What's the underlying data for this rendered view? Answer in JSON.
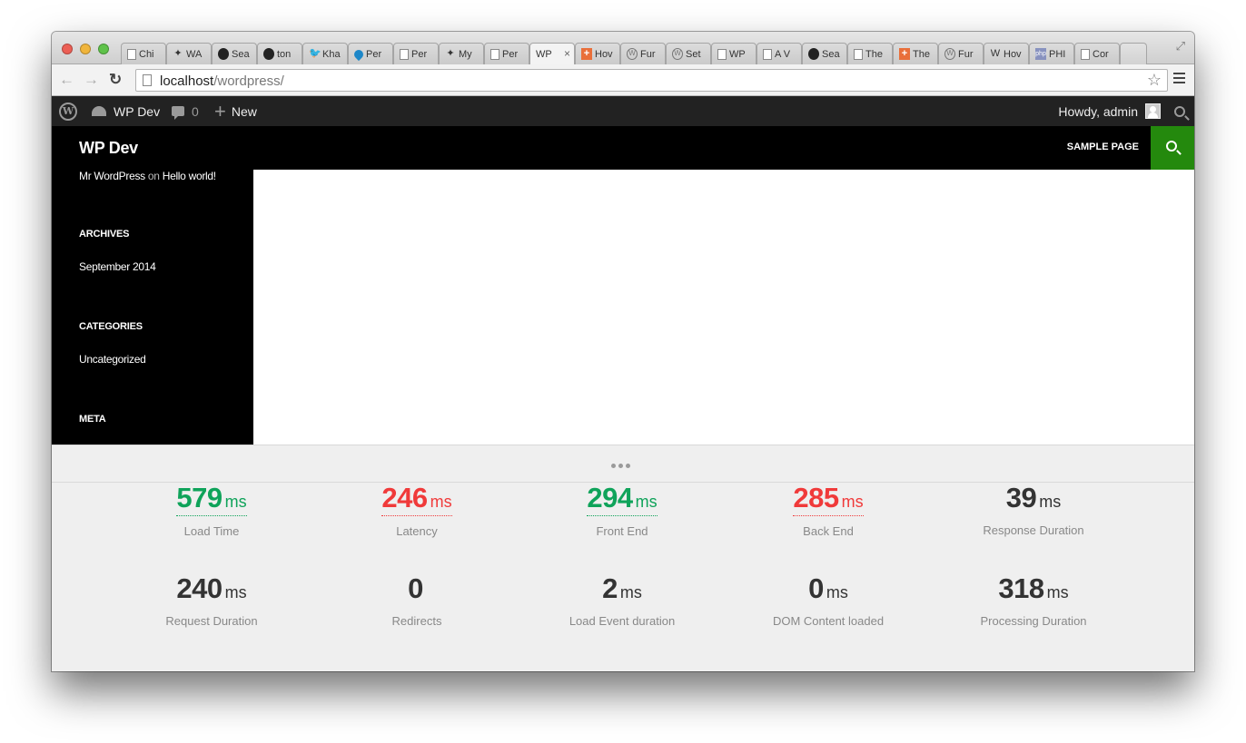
{
  "browser": {
    "tabs": [
      {
        "label": "Chi",
        "icon": "doc-icon"
      },
      {
        "label": "WA",
        "icon": "pinwheel-icon"
      },
      {
        "label": "Sea",
        "icon": "github-icon"
      },
      {
        "label": "ton",
        "icon": "github-icon"
      },
      {
        "label": "Kha",
        "icon": "twitter-icon"
      },
      {
        "label": "Per",
        "icon": "drupal-icon"
      },
      {
        "label": "Per",
        "icon": "doc-icon"
      },
      {
        "label": "My",
        "icon": "pinwheel-icon"
      },
      {
        "label": "Per",
        "icon": "doc-icon"
      },
      {
        "label": "WP",
        "icon": "none",
        "active": true
      },
      {
        "label": "Hov",
        "icon": "plus-cross-icon"
      },
      {
        "label": "Fur",
        "icon": "wordpress-icon"
      },
      {
        "label": "Set",
        "icon": "wordpress-icon"
      },
      {
        "label": "WP",
        "icon": "doc-icon"
      },
      {
        "label": "A V",
        "icon": "doc-icon"
      },
      {
        "label": "Sea",
        "icon": "github-icon"
      },
      {
        "label": "The",
        "icon": "doc-icon"
      },
      {
        "label": "The",
        "icon": "plus-cross-icon"
      },
      {
        "label": "Fur",
        "icon": "wordpress-icon"
      },
      {
        "label": "Hov",
        "icon": "wikipedia-icon"
      },
      {
        "label": "PHI",
        "icon": "php-icon"
      },
      {
        "label": "Cor",
        "icon": "doc-icon"
      }
    ],
    "url_host": "localhost",
    "url_path": "/wordpress/"
  },
  "adminbar": {
    "site_name": "WP Dev",
    "comment_count": "0",
    "new_label": "New",
    "howdy": "Howdy, admin"
  },
  "site": {
    "title": "WP Dev",
    "nav_sample_page": "SAMPLE PAGE"
  },
  "sidebar": {
    "recent_comment": {
      "author": "Mr WordPress",
      "on": "on",
      "post": "Hello world!"
    },
    "archives_title": "ARCHIVES",
    "archives_item": "September 2014",
    "categories_title": "CATEGORIES",
    "categories_item": "Uncategorized",
    "meta_title": "META"
  },
  "metrics": [
    {
      "value": "579",
      "unit": "ms",
      "label": "Load Time",
      "color": "#0fa35a"
    },
    {
      "value": "246",
      "unit": "ms",
      "label": "Latency",
      "color": "#f03a3a"
    },
    {
      "value": "294",
      "unit": "ms",
      "label": "Front End",
      "color": "#0fa35a"
    },
    {
      "value": "285",
      "unit": "ms",
      "label": "Back End",
      "color": "#f03a3a"
    },
    {
      "value": "39",
      "unit": "ms",
      "label": "Response Duration",
      "color": "#333333"
    },
    {
      "value": "240",
      "unit": "ms",
      "label": "Request Duration",
      "color": "#333333"
    },
    {
      "value": "0",
      "unit": "",
      "label": "Redirects",
      "color": "#333333"
    },
    {
      "value": "2",
      "unit": "ms",
      "label": "Load Event duration",
      "color": "#333333"
    },
    {
      "value": "0",
      "unit": "ms",
      "label": "DOM Content loaded",
      "color": "#333333"
    },
    {
      "value": "318",
      "unit": "ms",
      "label": "Processing Duration",
      "color": "#333333"
    }
  ],
  "colors": {
    "accent_green": "#24890d"
  }
}
